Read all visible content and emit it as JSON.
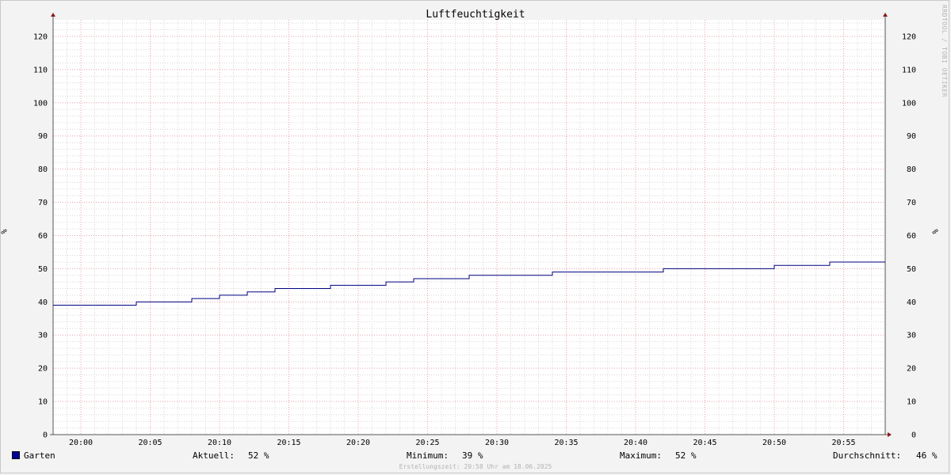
{
  "chart_data": {
    "type": "line",
    "title": "Luftfeuchtigkeit",
    "ylabel": "%",
    "ylim": [
      0,
      125
    ],
    "yticks": [
      0,
      10,
      20,
      30,
      40,
      50,
      60,
      70,
      80,
      90,
      100,
      110,
      120
    ],
    "xlim": [
      "19:58",
      "20:58"
    ],
    "xticks": [
      "20:00",
      "20:05",
      "20:10",
      "20:15",
      "20:20",
      "20:25",
      "20:30",
      "20:35",
      "20:40",
      "20:45",
      "20:50",
      "20:55"
    ],
    "grid": true,
    "series": [
      {
        "name": "Garten",
        "color": "#000080",
        "points": [
          [
            "19:58",
            39
          ],
          [
            "20:04",
            40
          ],
          [
            "20:08",
            41
          ],
          [
            "20:10",
            42
          ],
          [
            "20:12",
            43
          ],
          [
            "20:14",
            44
          ],
          [
            "20:18",
            45
          ],
          [
            "20:22",
            46
          ],
          [
            "20:24",
            47
          ],
          [
            "20:28",
            48
          ],
          [
            "20:34",
            49
          ],
          [
            "20:42",
            50
          ],
          [
            "20:50",
            51
          ],
          [
            "20:54",
            52
          ],
          [
            "20:58",
            52
          ]
        ]
      }
    ]
  },
  "legend": {
    "series_name": "Garten",
    "swatch_color": "#0000a0",
    "current_label": "Aktuell:",
    "current_value": "52 %",
    "min_label": "Minimum:",
    "min_value": "39 %",
    "max_label": "Maximum:",
    "max_value": "52 %",
    "avg_label": "Durchschnitt:",
    "avg_value": "46 %"
  },
  "watermark": "RRDTOOL / TOBI OETIKER",
  "footer": "Erstellungszeit: 20:58 Uhr am 18.06.2025"
}
